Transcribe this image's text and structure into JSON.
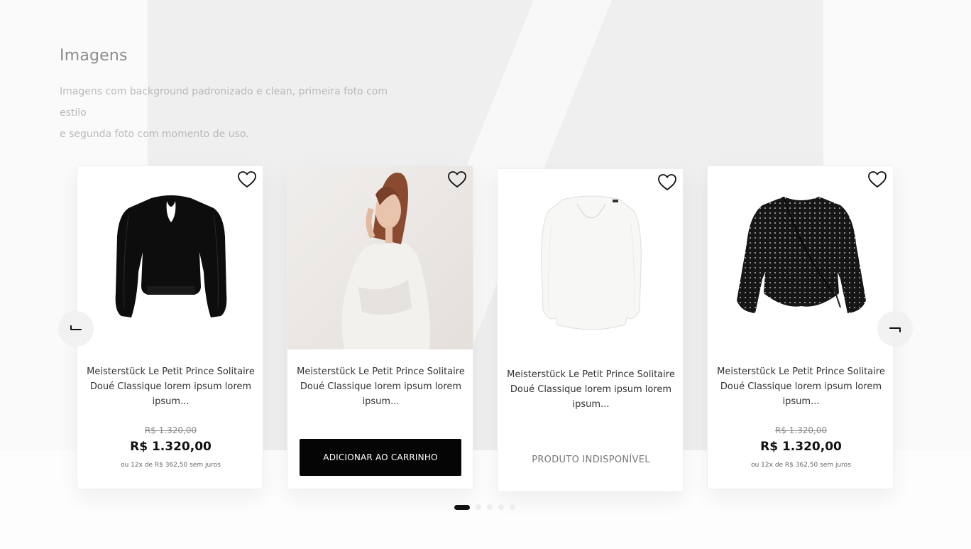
{
  "section": {
    "title": "Imagens",
    "description_line1": "Imagens com background padronizado e clean, primeira foto com estilo",
    "description_line2": "e segunda foto com momento de uso."
  },
  "carousel": {
    "prev_icon": "arrow-left-icon",
    "next_icon": "arrow-right-icon",
    "active_index": 0,
    "dot_count": 5
  },
  "products": [
    {
      "name": "Meisterstück Le Petit Prince Solitaire Doué Classique lorem ipsum lorem ipsum...",
      "old_price": "R$ 1.320,00",
      "price": "R$ 1.320,00",
      "installments": "ou 12x de R$ 362,50 sem juros",
      "image": "black-sheer-blouse",
      "favorite_icon": "heart-icon"
    },
    {
      "name": "Meisterstück Le Petit Prince Solitaire Doué Classique lorem ipsum lorem ipsum...",
      "cta": "ADICIONAR AO CARRINHO",
      "image": "model-white-shirt-photo",
      "favorite_icon": "heart-icon"
    },
    {
      "name": "Meisterstück Le Petit Prince Solitaire Doué Classique lorem ipsum lorem ipsum...",
      "status": "PRODUTO INDISPONÍVEL",
      "image": "white-sheer-blouse",
      "favorite_icon": "heart-icon"
    },
    {
      "name": "Meisterstück Le Petit Prince Solitaire Doué Classique lorem ipsum lorem ipsum...",
      "old_price": "R$ 1.320,00",
      "price": "R$ 1.320,00",
      "installments": "ou 12x de R$ 362,50 sem juros",
      "image": "black-dotted-wrap-blouse",
      "favorite_icon": "heart-icon"
    }
  ],
  "colors": {
    "accent": "#050505",
    "panel": "#efefef",
    "muted_text": "#b9b9b9"
  }
}
